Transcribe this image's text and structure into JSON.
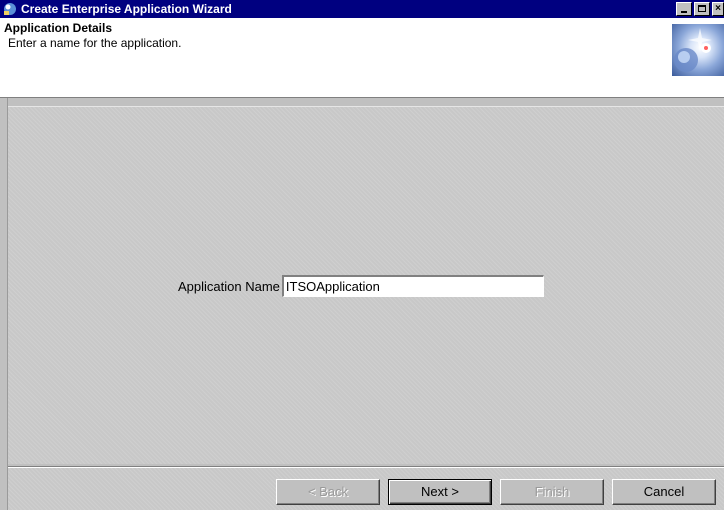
{
  "window": {
    "title": "Create Enterprise Application Wizard",
    "controls": [
      "minimize-icon",
      "maximize-icon",
      "close-icon"
    ]
  },
  "header": {
    "title": "Application Details",
    "subtitle": "Enter a name for the application."
  },
  "form": {
    "application_name_label": "Application Name",
    "application_name_value": "ITSOApplication"
  },
  "buttons": {
    "back": "< Back",
    "next": "Next >",
    "finish": "Finish",
    "cancel": "Cancel"
  },
  "colors": {
    "titlebar": "#000080",
    "dialog_bg": "#c0c0c0"
  }
}
